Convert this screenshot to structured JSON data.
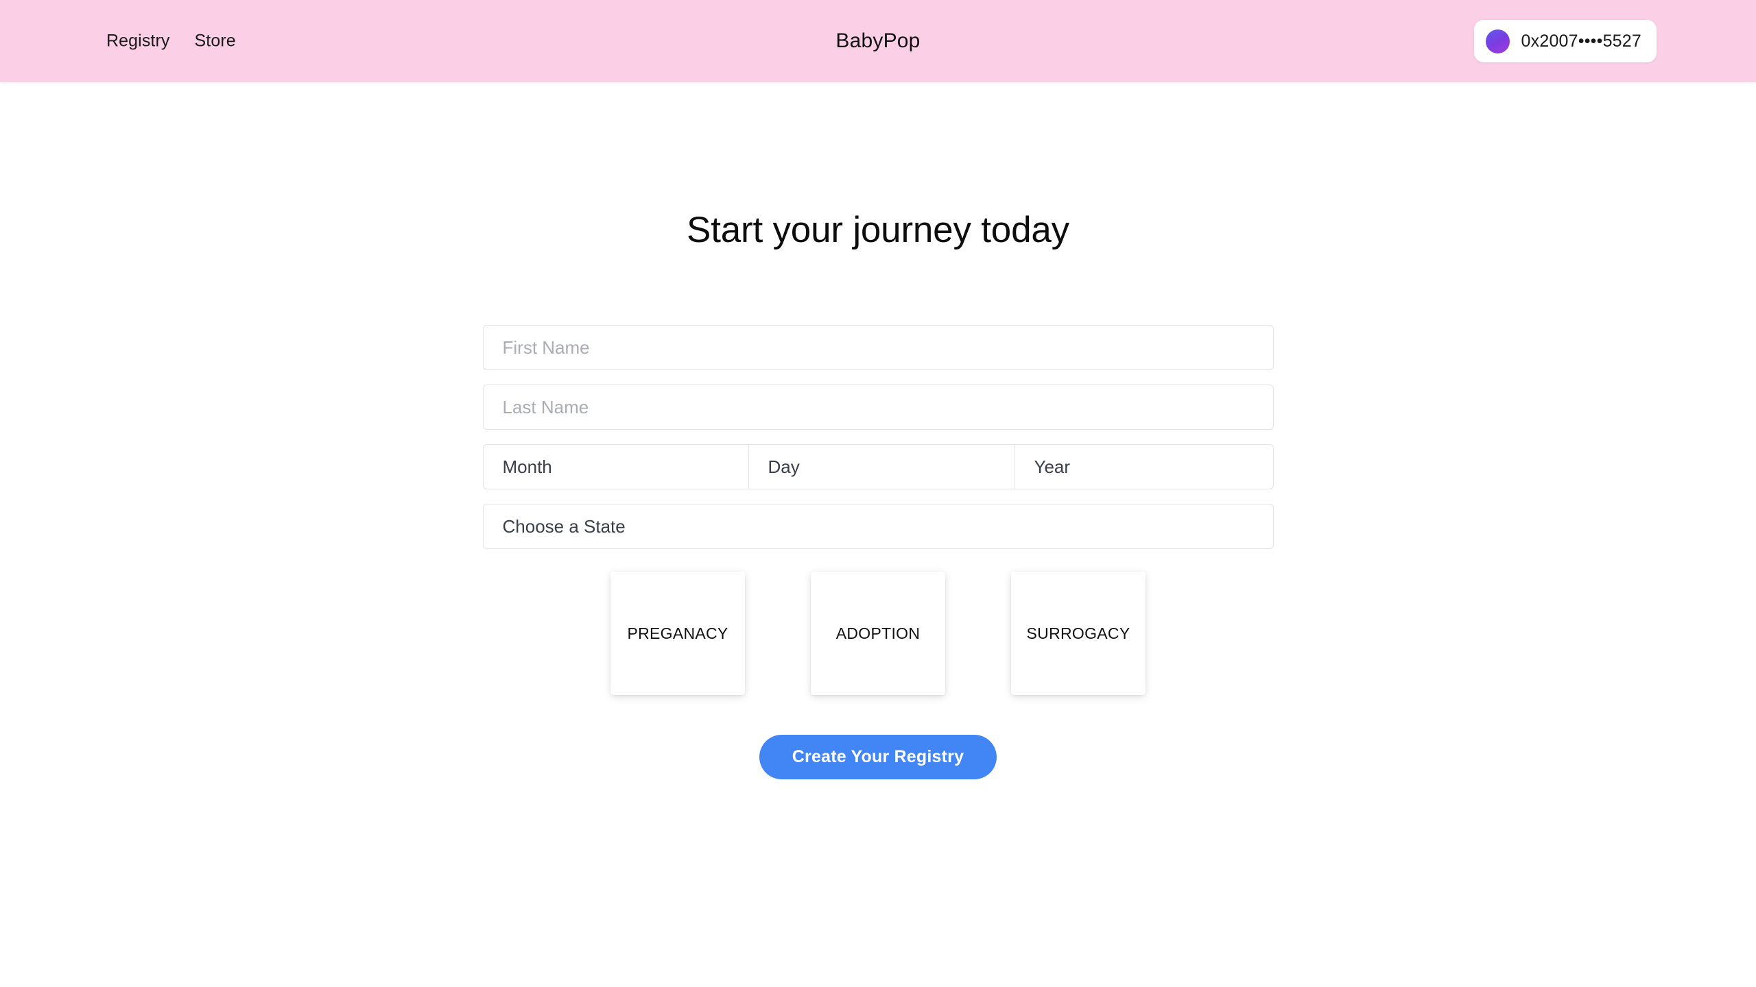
{
  "header": {
    "brand": "BabyPop",
    "nav": [
      {
        "label": "Registry"
      },
      {
        "label": "Store"
      }
    ],
    "wallet": {
      "address": "0x2007••••5527",
      "avatar_gradient_from": "#5b5bf0",
      "avatar_gradient_to": "#a23ce0"
    },
    "background_color": "#fbd0e7"
  },
  "main": {
    "title": "Start your journey today",
    "form": {
      "first_name": {
        "placeholder": "First Name",
        "value": ""
      },
      "last_name": {
        "placeholder": "Last Name",
        "value": ""
      },
      "month": {
        "selected": "Month"
      },
      "day": {
        "selected": "Day"
      },
      "year": {
        "selected": "Year"
      },
      "state": {
        "selected": "Choose a State"
      }
    },
    "journey_options": [
      {
        "label": "PREGANACY"
      },
      {
        "label": "ADOPTION"
      },
      {
        "label": "SURROGACY"
      }
    ],
    "cta": {
      "label": "Create Your Registry",
      "color": "#4285f4"
    }
  }
}
